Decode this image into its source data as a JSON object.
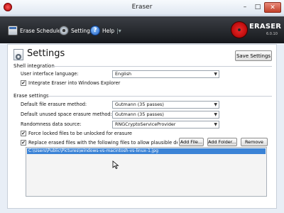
{
  "window": {
    "title": "Eraser",
    "minimize": "–",
    "maximize": "□",
    "close": "✕"
  },
  "toolbar": {
    "items": [
      {
        "label": "Erase Schedule",
        "icon": "calendar-icon",
        "dropdown": "|▾"
      },
      {
        "label": "Settings",
        "icon": "gear-icon"
      },
      {
        "label": "Help",
        "icon": "help-icon",
        "dropdown": "|▾"
      }
    ],
    "help_glyph": "?",
    "logo": {
      "text": "ERASER",
      "version": "6.0.10"
    }
  },
  "settings": {
    "title": "Settings",
    "save_button": "Save Settings",
    "shell": {
      "heading": "Shell integration",
      "language_label": "User interface language:",
      "language_value": "English",
      "integrate_label": "Integrate Eraser into Windows Explorer",
      "integrate_checked": true
    },
    "erase": {
      "heading": "Erase settings",
      "file_method_label": "Default file erasure method:",
      "file_method_value": "Gutmann (35 passes)",
      "unused_method_label": "Default unused space erasure method:",
      "unused_method_value": "Gutmann (35 passes)",
      "random_label": "Randomness data source:",
      "random_value": "RNGCryptoServiceProvider",
      "force_unlock_label": "Force locked files to be unlocked for erasure",
      "force_unlock_checked": true,
      "replace_label": "Replace erased files with the following files to allow plausible deniability",
      "replace_checked": true,
      "add_file_button": "Add File...",
      "add_folder_button": "Add Folder...",
      "remove_button": "Remove",
      "files": [
        "C:\\Users\\Public\\Pictures\\windows-vs-macintosh-vs-linux-1.jpg"
      ]
    }
  },
  "colors": {
    "toolbar_bg": "#1f2125",
    "selection": "#3b83d6",
    "close_button": "#c2412b"
  }
}
